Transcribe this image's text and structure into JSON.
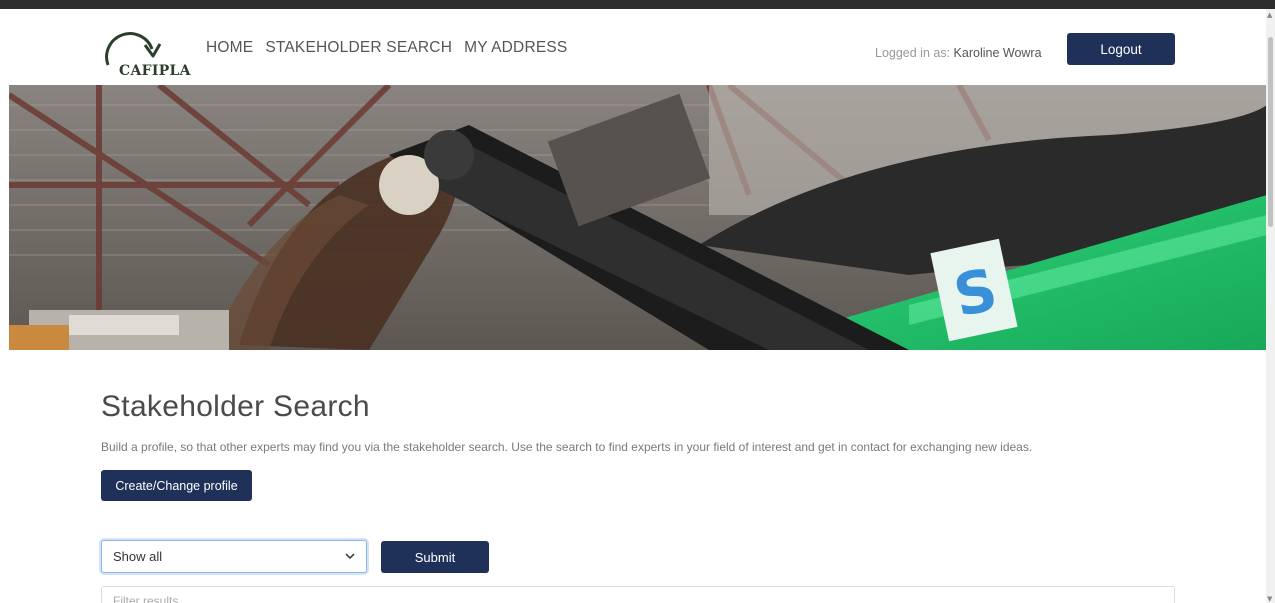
{
  "header": {
    "logo_text": "CAFIPLA",
    "nav": [
      "HOME",
      "STAKEHOLDER SEARCH",
      "MY ADDRESS"
    ],
    "logged_in_label": "Logged in as:",
    "user_name": "Karoline Wowra",
    "logout_label": "Logout"
  },
  "hero": {
    "logo_glyph": "S"
  },
  "main": {
    "title": "Stakeholder Search",
    "description": "Build a profile, so that other experts may find you via the stakeholder search. Use the search to find experts in your field of interest and get in contact for exchanging new ideas.",
    "profile_button": "Create/Change profile",
    "select_value": "Show all",
    "submit_label": "Submit",
    "filter_placeholder": "Filter results"
  },
  "colors": {
    "primary": "#1f3059",
    "focus_border": "#8bb5e8",
    "logo_green": "#2b3f2b",
    "machine_green": "#1fc46a"
  }
}
